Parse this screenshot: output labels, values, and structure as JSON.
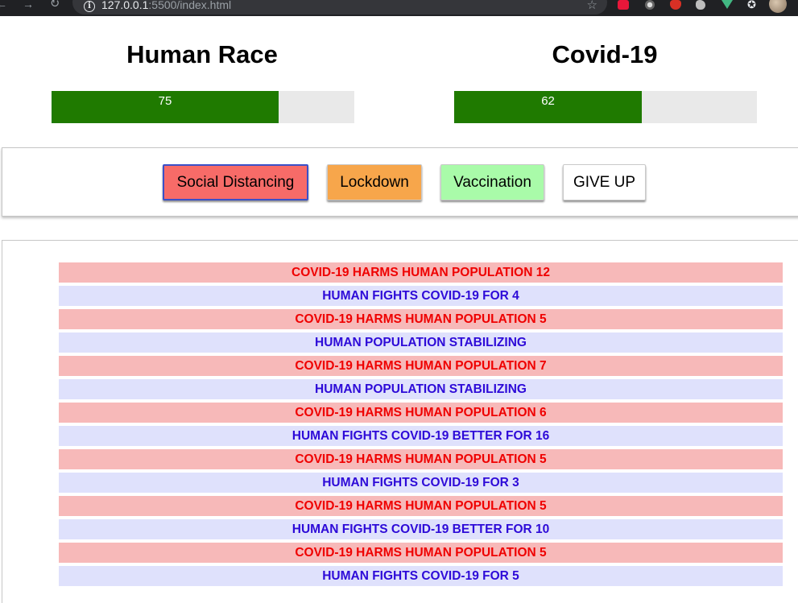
{
  "browser": {
    "url_host": "127.0.0.1",
    "url_rest": ":5500/index.html",
    "icons": [
      "back-arrow-icon",
      "forward-arrow-icon",
      "reload-icon",
      "info-icon",
      "star-icon",
      "puzzle-extension-icon"
    ]
  },
  "players": {
    "human": {
      "title": "Human Race",
      "health": "75",
      "health_fraction": 0.75
    },
    "covid": {
      "title": "Covid-19",
      "health": "62",
      "health_fraction": 0.62
    }
  },
  "controls": {
    "social_distancing": "Social Distancing",
    "lockdown": "Lockdown",
    "vaccination": "Vaccination",
    "give_up": "GIVE UP"
  },
  "colors": {
    "health_fill": "#1f7a00",
    "covid_log_bg": "#f7b9b9",
    "covid_log_text": "#ef0000",
    "human_log_bg": "#dfe1fc",
    "human_log_text": "#2d0ad8",
    "social_button": "#f76b68",
    "lockdown_button": "#f7a64b",
    "vaccination_button": "#a9fba9"
  },
  "log": [
    {
      "side": "covid",
      "text": "COVID-19 HARMS HUMAN POPULATION 12"
    },
    {
      "side": "human",
      "text": "HUMAN FIGHTS COVID-19 FOR 4"
    },
    {
      "side": "covid",
      "text": "COVID-19 HARMS HUMAN POPULATION 5"
    },
    {
      "side": "human",
      "text": "HUMAN POPULATION STABILIZING"
    },
    {
      "side": "covid",
      "text": "COVID-19 HARMS HUMAN POPULATION 7"
    },
    {
      "side": "human",
      "text": "HUMAN POPULATION STABILIZING"
    },
    {
      "side": "covid",
      "text": "COVID-19 HARMS HUMAN POPULATION 6"
    },
    {
      "side": "human",
      "text": "HUMAN FIGHTS COVID-19 BETTER FOR 16"
    },
    {
      "side": "covid",
      "text": "COVID-19 HARMS HUMAN POPULATION 5"
    },
    {
      "side": "human",
      "text": "HUMAN FIGHTS COVID-19 FOR 3"
    },
    {
      "side": "covid",
      "text": "COVID-19 HARMS HUMAN POPULATION 5"
    },
    {
      "side": "human",
      "text": "HUMAN FIGHTS COVID-19 BETTER FOR 10"
    },
    {
      "side": "covid",
      "text": "COVID-19 HARMS HUMAN POPULATION 5"
    },
    {
      "side": "human",
      "text": "HUMAN FIGHTS COVID-19 FOR 5"
    }
  ]
}
